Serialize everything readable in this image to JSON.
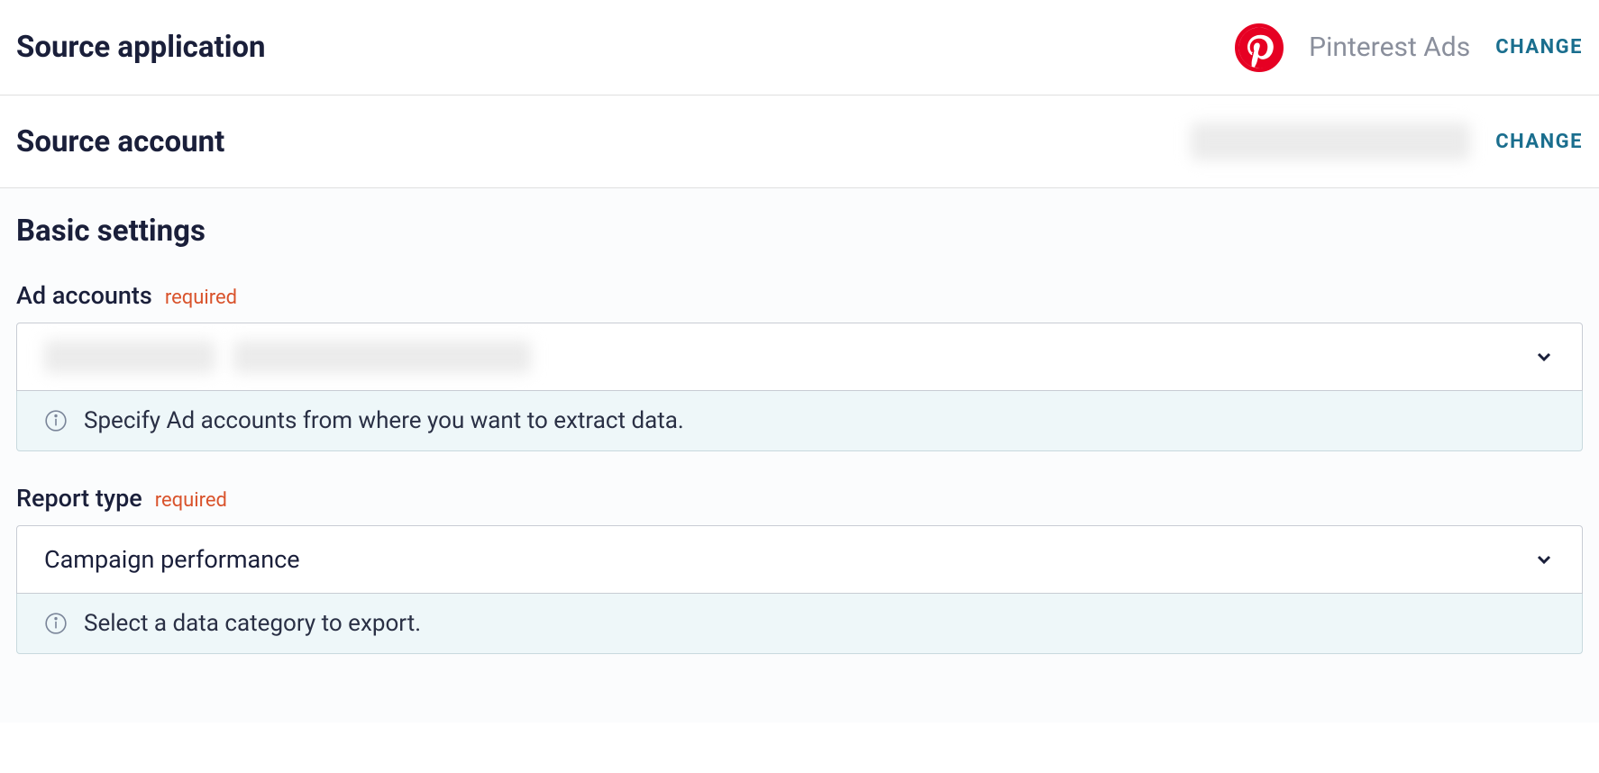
{
  "source_application": {
    "title": "Source application",
    "app_name": "Pinterest Ads",
    "change_label": "CHANGE"
  },
  "source_account": {
    "title": "Source account",
    "change_label": "CHANGE"
  },
  "basic_settings": {
    "title": "Basic settings",
    "ad_accounts": {
      "label": "Ad accounts",
      "required": "required",
      "helper": "Specify Ad accounts from where you want to extract data."
    },
    "report_type": {
      "label": "Report type",
      "required": "required",
      "value": "Campaign performance",
      "helper": "Select a data category to export."
    }
  }
}
